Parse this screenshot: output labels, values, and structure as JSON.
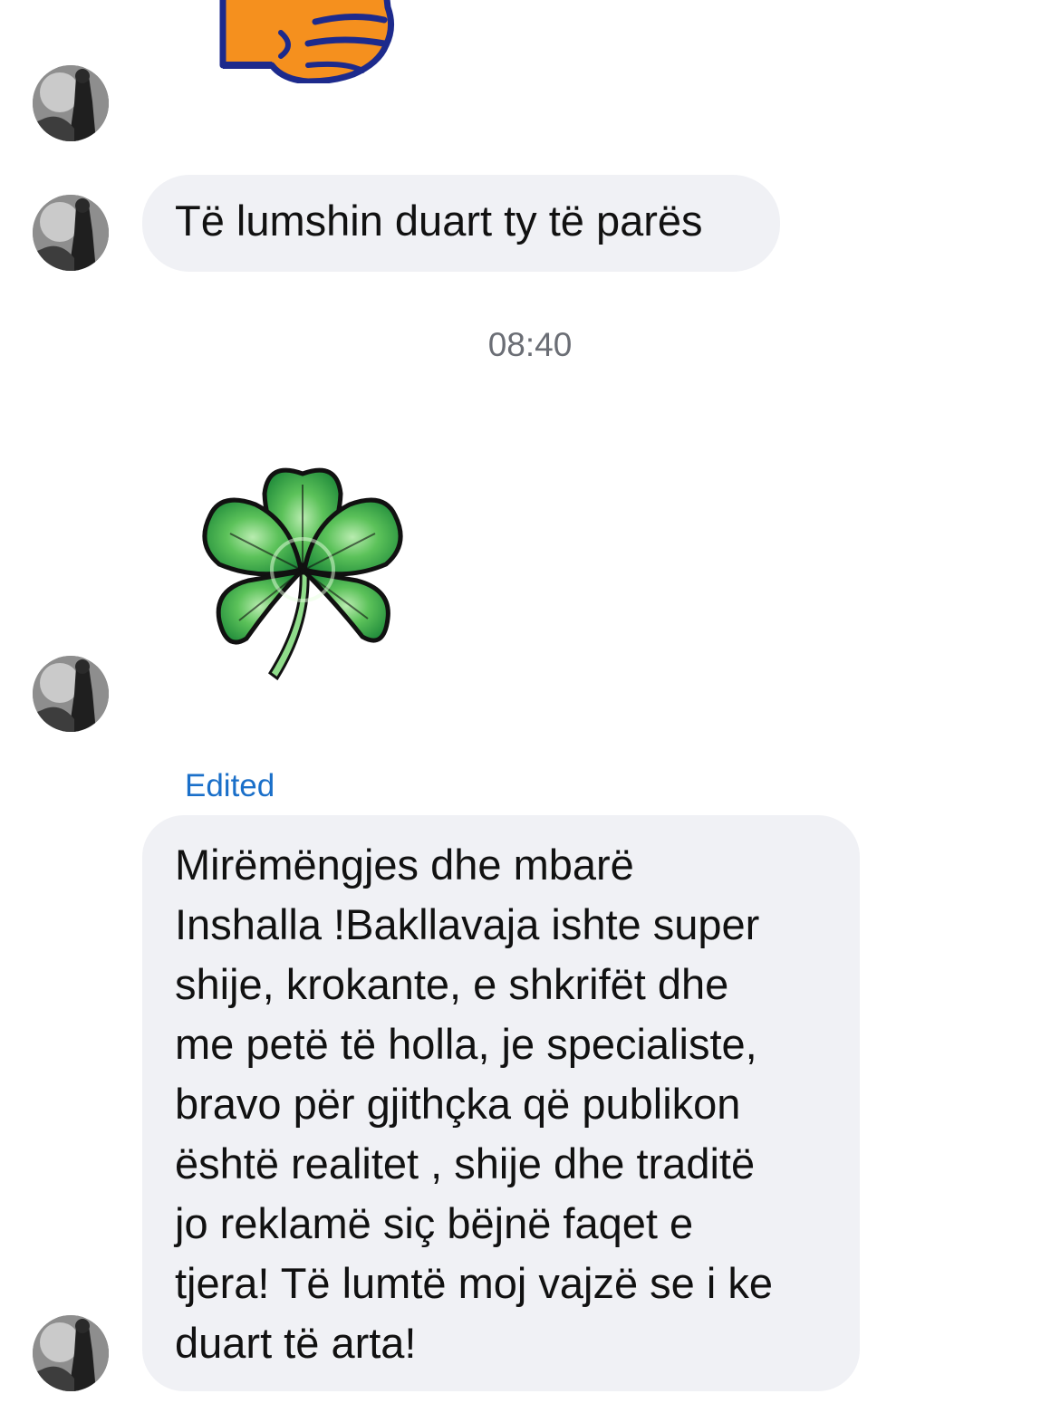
{
  "messages": [
    {
      "type": "sticker",
      "sticker": "thumbs-up-icon"
    },
    {
      "type": "text",
      "text": "Të lumshin duart ty të parës"
    },
    {
      "type": "sticker",
      "sticker": "four-leaf-clover-icon"
    },
    {
      "type": "text",
      "status": "Edited",
      "lines": [
        "Mirëmëngjes dhe mbarë",
        "Inshalla !Bakllavaja ishte super",
        "shije, krokante, e shkrifët dhe",
        "me petë të holla, je specialiste,",
        "bravo për gjithçka që publikon",
        "është realitet , shije dhe traditë",
        "jo reklamë siç bëjnë faqet e",
        "tjera! Të lumtë moj vajzë se i ke",
        "duart të arta!"
      ]
    }
  ],
  "timestamp": "08:40",
  "colors": {
    "bubble_bg": "#f0f1f5",
    "edited_label": "#1a6fc9",
    "timestamp": "#6b6e75"
  }
}
